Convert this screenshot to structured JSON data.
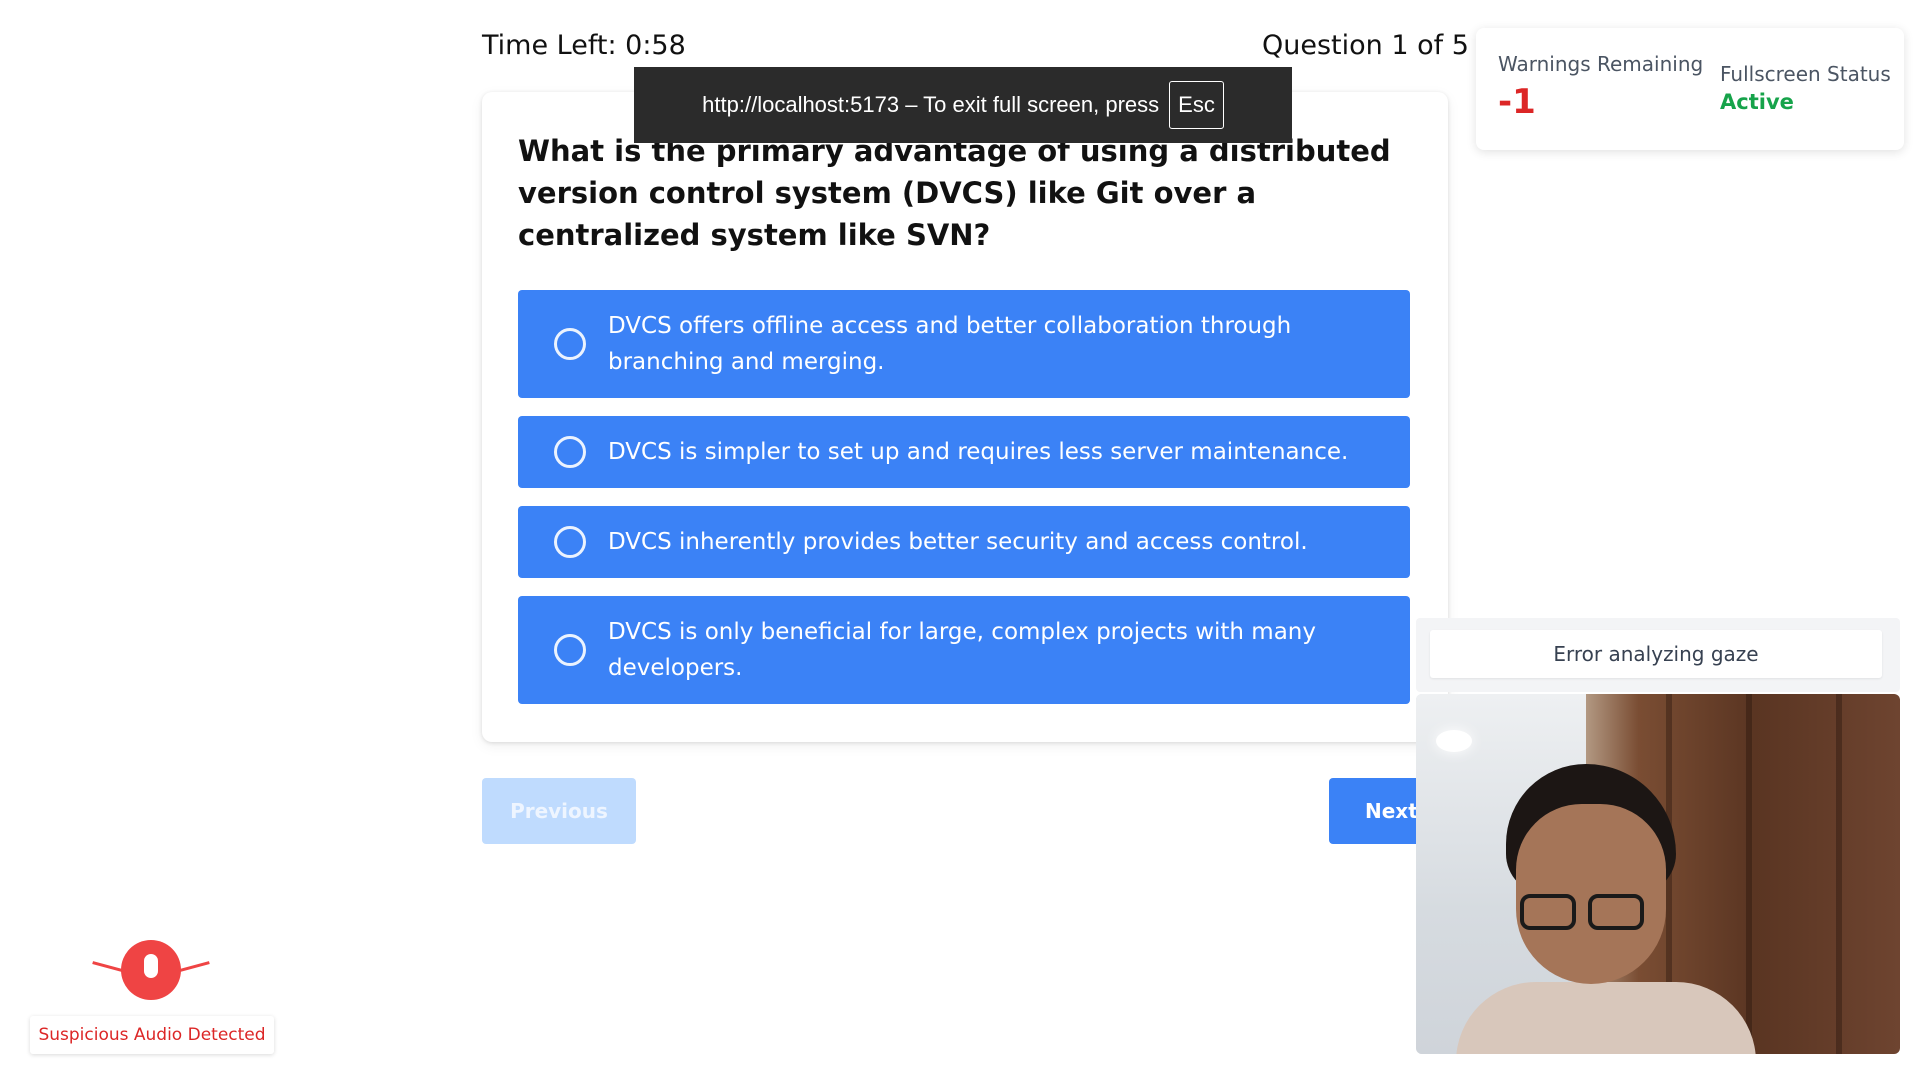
{
  "header": {
    "time_left": "Time Left: 0:58",
    "question_counter": "Question 1 of 5"
  },
  "fullscreen_banner": {
    "message": "http://localhost:5173 – To exit full screen, press",
    "key": "Esc"
  },
  "question": {
    "text": "What is the primary advantage of using a distributed version control system (DVCS) like Git over a centralized system like SVN?",
    "options": [
      {
        "label": "DVCS offers offline access and better collaboration through branching and merging."
      },
      {
        "label": "DVCS is simpler to set up and requires less server maintenance."
      },
      {
        "label": "DVCS inherently provides better security and access control."
      },
      {
        "label": "DVCS is only beneficial for large, complex projects with many developers."
      }
    ]
  },
  "navigation": {
    "previous_label": "Previous",
    "next_label": "Next"
  },
  "status_panel": {
    "warnings_label": "Warnings Remaining",
    "warnings_value": "-1",
    "fullscreen_label": "Fullscreen Status",
    "fullscreen_value": "Active"
  },
  "proctoring": {
    "gaze_message": "Error analyzing gaze",
    "audio_alert": "Suspicious Audio Detected"
  },
  "colors": {
    "option_bg": "#3b82f6",
    "warning_red": "#dc2626",
    "status_green": "#16a34a"
  }
}
